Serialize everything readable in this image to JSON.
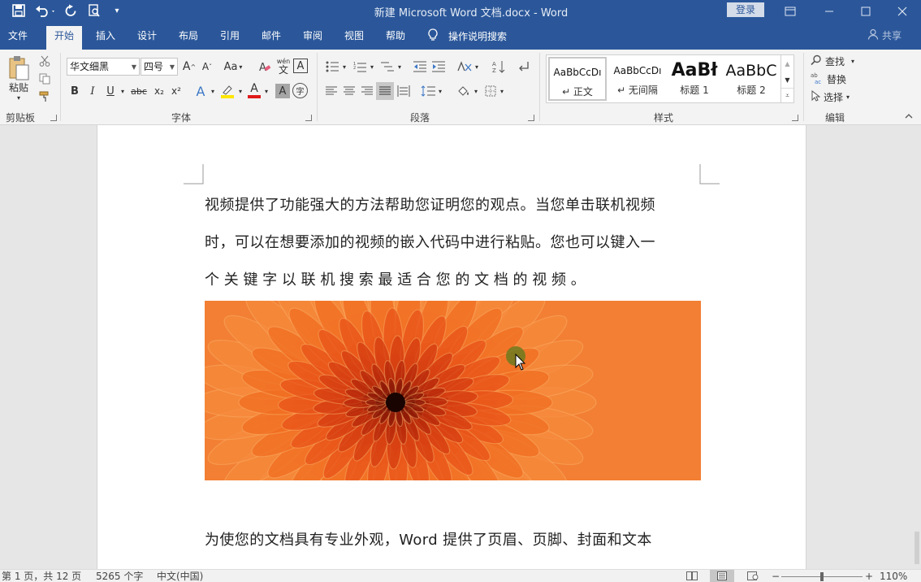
{
  "window": {
    "title": "新建 Microsoft Word 文档.docx  -  Word",
    "login_label": "登录"
  },
  "ribbon_tabs": [
    "文件",
    "开始",
    "插入",
    "设计",
    "布局",
    "引用",
    "邮件",
    "审阅",
    "视图",
    "帮助"
  ],
  "active_tab": "开始",
  "tell_me": "操作说明搜索",
  "share_label": "共享",
  "clipboard": {
    "paste_label": "粘贴",
    "group_label": "剪贴板"
  },
  "font": {
    "font_name": "华文细黑",
    "font_size": "四号",
    "case_label": "Aa",
    "phonetic_label": "wén",
    "bold": "B",
    "italic": "I",
    "underline": "U",
    "strike": "abc",
    "subscript": "x₂",
    "superscript": "x²",
    "effects": "A",
    "color_letter": "A",
    "shade_letter": "A",
    "enclose": "字",
    "group_label": "字体",
    "highlight_color": "#ffe600",
    "font_color": "#e01b1b"
  },
  "paragraph": {
    "group_label": "段落"
  },
  "styles": {
    "items": [
      {
        "preview": "AaBbCcDı",
        "name": "↵ 正文"
      },
      {
        "preview": "AaBbCcDı",
        "name": "↵ 无间隔"
      },
      {
        "preview": "AaBł",
        "name": "标题 1"
      },
      {
        "preview": "AaBbC",
        "name": "标题 2"
      }
    ],
    "group_label": "样式"
  },
  "editing": {
    "find_label": "查找",
    "replace_label": "替换",
    "select_label": "选择",
    "group_label": "编辑"
  },
  "document": {
    "paragraph1_lines": [
      "视频提供了功能强大的方法帮助您证明您的观点。当您单击联机视频",
      "时，可以在想要添加的视频的嵌入代码中进行粘贴。您也可以键入一",
      "个 关 键 字 以 联 机 搜 索 最 适 合 您 的 文 档 的 视 频 。"
    ],
    "paragraph2_line": "为使您的文档具有专业外观，Word 提供了页眉、页脚、封面和文本",
    "image_subject": "orange-chrysanthemum-photo"
  },
  "status": {
    "page": "第 1 页，共 12 页",
    "words": "5265 个字",
    "language": "中文(中国)",
    "zoom": "110%",
    "minus": "−",
    "plus": "+"
  },
  "colors": {
    "title_bar": "#2b579a",
    "ribbon": "#f3f3f3",
    "page": "#ffffff",
    "canvas": "#e6e6e6"
  }
}
